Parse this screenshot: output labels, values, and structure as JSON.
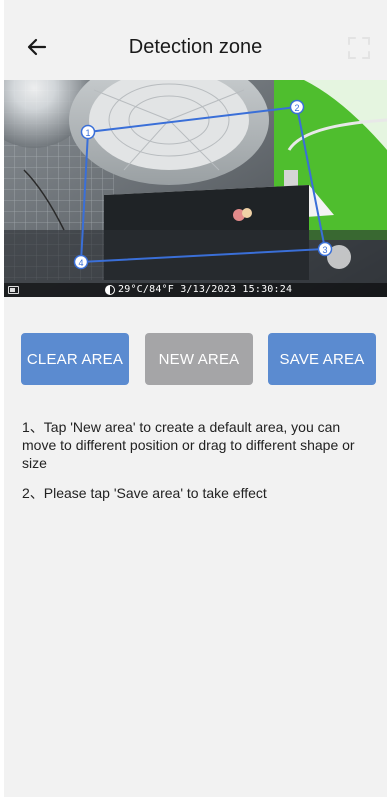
{
  "header": {
    "title": "Detection zone",
    "back_icon": "arrow-left-icon",
    "fullscreen_icon": "fullscreen-icon"
  },
  "camera": {
    "osd_text": "29°C/84°F 3/13/2023 15:30:24",
    "zone_color": "#3a6fd8",
    "zone_points": [
      {
        "label": "1"
      },
      {
        "label": "2"
      },
      {
        "label": "3"
      },
      {
        "label": "4"
      }
    ]
  },
  "buttons": {
    "clear_area": "CLEAR AREA",
    "new_area": "NEW AREA",
    "save_area": "SAVE AREA"
  },
  "colors": {
    "primary_button": "#5b8bd0",
    "disabled_button": "#a5a5a7",
    "background": "#f2f2f2"
  },
  "instructions": [
    "1、Tap 'New area' to create a default area, you can move to different position or drag to different shape or size",
    "2、Please tap 'Save area' to take effect"
  ]
}
